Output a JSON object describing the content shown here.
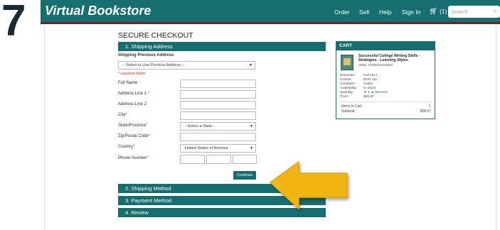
{
  "step_number": "7",
  "navbar": {
    "brand": "Virtual Bookstore",
    "links": [
      "Order",
      "Sell",
      "Help",
      "Sign In"
    ],
    "cart_label": "(1)",
    "search_placeholder": "Search"
  },
  "checkout": {
    "title": "SECURE CHECKOUT",
    "section1": "1. Shipping Address",
    "prev_address_label": "Shipping Previous Address",
    "prev_address_value": "-- Select to Use Previous Address --",
    "required_note": "* required fields",
    "fields": {
      "full_name": "Full Name",
      "address1": "Address Line 1",
      "address2": "Address Line 2",
      "city": "City",
      "state": "State/Province",
      "state_value": "--Select a State--",
      "zip": "Zip/Postal Code",
      "country": "Country",
      "country_value": "United States of America",
      "phone": "Phone Number"
    },
    "required_mark": "*",
    "continue_label": "Continue",
    "section2": "2. Shipping Method",
    "section3": "3. Payment Method",
    "section4": "4. Review"
  },
  "cart": {
    "header": "CART",
    "book_title": "Successful College Writing Skills - Strategies - Learning Styles",
    "isbn": "ISBN: 9780312676087",
    "details": {
      "semester_label": "Semester:",
      "semester": "Fall 2017",
      "course_label": "Course:",
      "course": "ENG 111",
      "condition_label": "Condition:",
      "condition": "USED",
      "availability_label": "Availability:",
      "availability": "In Stock",
      "quantity_label": "Quantity:",
      "quantity": "1",
      "remove_label": "Remove",
      "price_label": "Price:",
      "price": "$28.57"
    },
    "items_label": "Items in Cart:",
    "items_count": "1",
    "subtotal_label": "Subtotal:",
    "subtotal": "$28.57"
  },
  "colors": {
    "teal": "#166e71",
    "arrow": "#f2b511",
    "required": "#c0392b"
  }
}
